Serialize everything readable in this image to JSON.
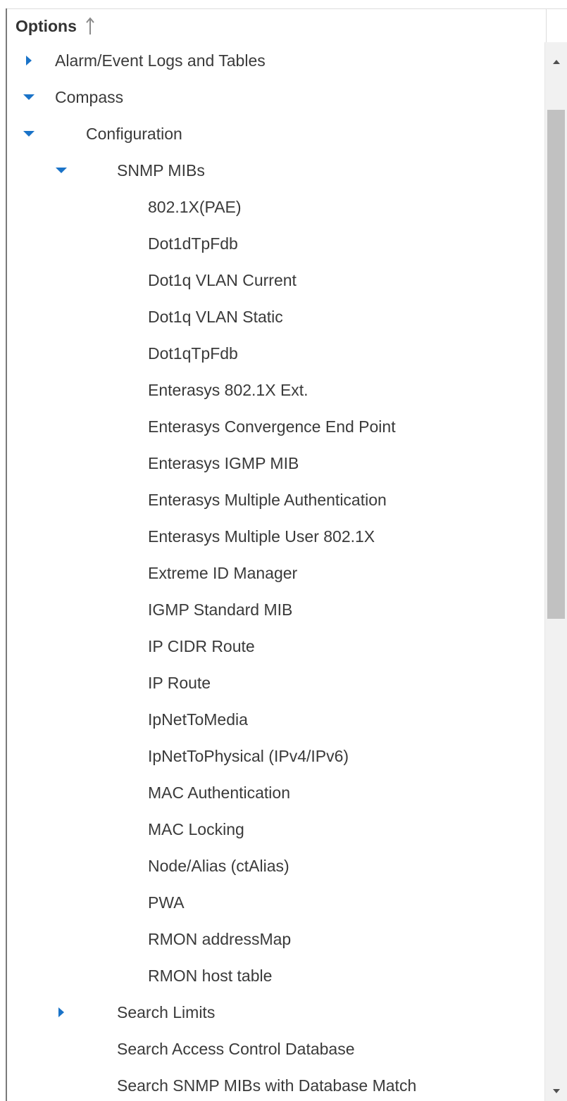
{
  "header": {
    "title": "Options",
    "sort_icon": "arrow-up-icon"
  },
  "colors": {
    "accent": "#1a73c8",
    "text": "#3a3a3a",
    "scroll_thumb": "#c1c1c1"
  },
  "tree": [
    {
      "label": "Alarm/Event Logs and Tables",
      "level": 0,
      "toggle": "collapsed"
    },
    {
      "label": "Compass",
      "level": 0,
      "toggle": "expanded"
    },
    {
      "label": "Configuration",
      "level": 1,
      "toggle": "expanded"
    },
    {
      "label": "SNMP MIBs",
      "level": 2,
      "toggle": "expanded"
    },
    {
      "label": "802.1X(PAE)",
      "level": 3,
      "toggle": "none"
    },
    {
      "label": "Dot1dTpFdb",
      "level": 3,
      "toggle": "none"
    },
    {
      "label": "Dot1q VLAN Current",
      "level": 3,
      "toggle": "none"
    },
    {
      "label": "Dot1q VLAN Static",
      "level": 3,
      "toggle": "none"
    },
    {
      "label": "Dot1qTpFdb",
      "level": 3,
      "toggle": "none"
    },
    {
      "label": "Enterasys 802.1X Ext.",
      "level": 3,
      "toggle": "none"
    },
    {
      "label": "Enterasys Convergence End Point",
      "level": 3,
      "toggle": "none"
    },
    {
      "label": "Enterasys IGMP MIB",
      "level": 3,
      "toggle": "none"
    },
    {
      "label": "Enterasys Multiple Authentication",
      "level": 3,
      "toggle": "none"
    },
    {
      "label": "Enterasys Multiple User 802.1X",
      "level": 3,
      "toggle": "none"
    },
    {
      "label": "Extreme ID Manager",
      "level": 3,
      "toggle": "none"
    },
    {
      "label": "IGMP Standard MIB",
      "level": 3,
      "toggle": "none"
    },
    {
      "label": "IP CIDR Route",
      "level": 3,
      "toggle": "none"
    },
    {
      "label": "IP Route",
      "level": 3,
      "toggle": "none"
    },
    {
      "label": "IpNetToMedia",
      "level": 3,
      "toggle": "none"
    },
    {
      "label": "IpNetToPhysical (IPv4/IPv6)",
      "level": 3,
      "toggle": "none"
    },
    {
      "label": "MAC Authentication",
      "level": 3,
      "toggle": "none"
    },
    {
      "label": "MAC Locking",
      "level": 3,
      "toggle": "none"
    },
    {
      "label": "Node/Alias (ctAlias)",
      "level": 3,
      "toggle": "none"
    },
    {
      "label": "PWA",
      "level": 3,
      "toggle": "none"
    },
    {
      "label": "RMON addressMap",
      "level": 3,
      "toggle": "none"
    },
    {
      "label": "RMON host table",
      "level": 3,
      "toggle": "none"
    },
    {
      "label": "Search Limits",
      "level": 2,
      "toggle": "collapsed"
    },
    {
      "label": "Search Access Control Database",
      "level": 2,
      "toggle": "none"
    },
    {
      "label": "Search SNMP MIBs with Database Match",
      "level": 2,
      "toggle": "none"
    }
  ]
}
